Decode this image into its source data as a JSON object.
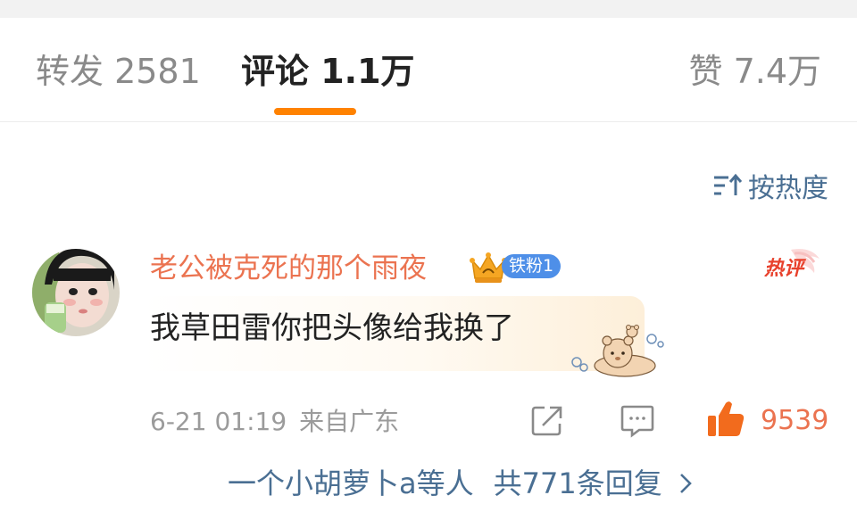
{
  "tabs": {
    "repost": "转发 2581",
    "comment": "评论 1.1万",
    "like": "赞 7.4万"
  },
  "sort": {
    "label": "按热度",
    "icon": "sort-icon"
  },
  "comment": {
    "username": "老公被克死的那个雨夜",
    "fan_badge": "铁粉1",
    "hot_tag": "热评",
    "text": "我草田雷你把头像给我换了",
    "date": "6-21 01:19",
    "source": "来自广东",
    "likes": "9539",
    "replies_users": "一个小胡萝卜a等人",
    "replies_total": "共771条回复"
  },
  "colors": {
    "accent": "#ff8200",
    "username": "#eb7350",
    "link": "#4a6f93",
    "badge": "#4e8fe8"
  }
}
